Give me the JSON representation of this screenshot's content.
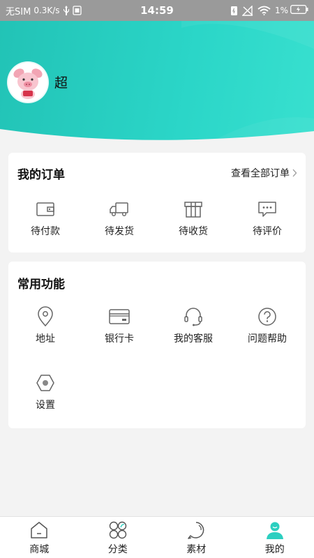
{
  "status_bar": {
    "carrier": "无SIM",
    "speed": "0.3K/s",
    "time": "14:59",
    "battery": "1%"
  },
  "profile": {
    "username": "超",
    "avatar_icon": "pig-avatar-icon"
  },
  "orders": {
    "title": "我的订单",
    "view_all": "查看全部订单",
    "items": [
      {
        "label": "待付款",
        "icon": "wallet-icon"
      },
      {
        "label": "待发货",
        "icon": "truck-icon"
      },
      {
        "label": "待收货",
        "icon": "box-icon"
      },
      {
        "label": "待评价",
        "icon": "comment-icon"
      }
    ]
  },
  "functions": {
    "title": "常用功能",
    "items": [
      {
        "label": "地址",
        "icon": "location-pin-icon"
      },
      {
        "label": "银行卡",
        "icon": "bank-card-icon"
      },
      {
        "label": "我的客服",
        "icon": "headset-icon"
      },
      {
        "label": "问题帮助",
        "icon": "help-icon"
      },
      {
        "label": "设置",
        "icon": "settings-hexagon-icon"
      }
    ]
  },
  "bottom_nav": {
    "items": [
      {
        "label": "商城",
        "icon": "home-icon",
        "active": false
      },
      {
        "label": "分类",
        "icon": "category-icon",
        "active": false
      },
      {
        "label": "素材",
        "icon": "material-icon",
        "active": false
      },
      {
        "label": "我的",
        "icon": "profile-icon",
        "active": true
      }
    ]
  },
  "colors": {
    "accent": "#2bd6c8",
    "active_nav": "#2ccfc0",
    "status_bar": "#9a9a9a",
    "background": "#f3f3f3"
  }
}
